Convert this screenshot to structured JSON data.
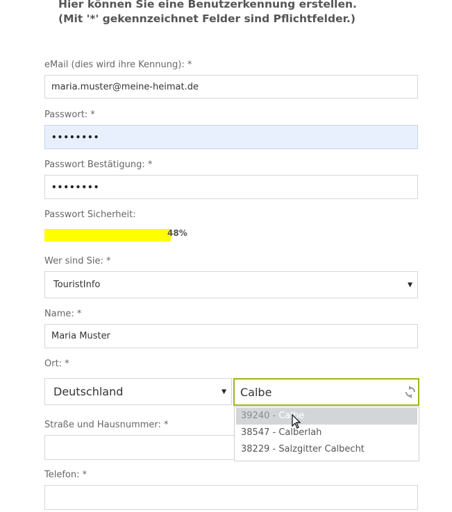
{
  "heading": {
    "line1": "Hier können Sie eine Benutzerkennung erstellen.",
    "line2": "(Mit '*' gekennzeichnet Felder sind Pflichtfelder.)"
  },
  "fields": {
    "email": {
      "label": "eMail (dies wird ihre Kennung): *",
      "value": "maria.muster@meine-heimat.de"
    },
    "password": {
      "label": "Passwort: *",
      "value": "••••••••"
    },
    "password_confirm": {
      "label": "Passwort Bestätigung: *",
      "value": "••••••••"
    },
    "strength": {
      "label": "Passwort Sicherheit:",
      "percent_text": "48%",
      "percent": 48
    },
    "who": {
      "label": "Wer sind Sie: *",
      "selected": "TouristInfo",
      "caret": "▼"
    },
    "name": {
      "label": "Name: *",
      "value": "Maria Muster"
    },
    "location": {
      "label": "Ort: *",
      "country": "Deutschland",
      "city": "Calbe",
      "caret": "▼",
      "spinner_icon": "refresh-icon"
    },
    "street": {
      "label": "Straße und Hausnummer: *",
      "value": ""
    },
    "phone": {
      "label": "Telefon: *",
      "value": ""
    }
  },
  "autocomplete": [
    {
      "zip": "39240",
      "sep": " - ",
      "name": "Calbe",
      "active": true
    },
    {
      "zip": "38547",
      "sep": " - ",
      "name": "Calberlah",
      "active": false
    },
    {
      "zip": "38229",
      "sep": " - ",
      "name": "Salzgitter Calbecht",
      "active": false
    }
  ],
  "colors": {
    "strength_bar": "#ffff00",
    "focus_border": "#9ab51e",
    "autofill_bg": "#e8f0fe"
  }
}
